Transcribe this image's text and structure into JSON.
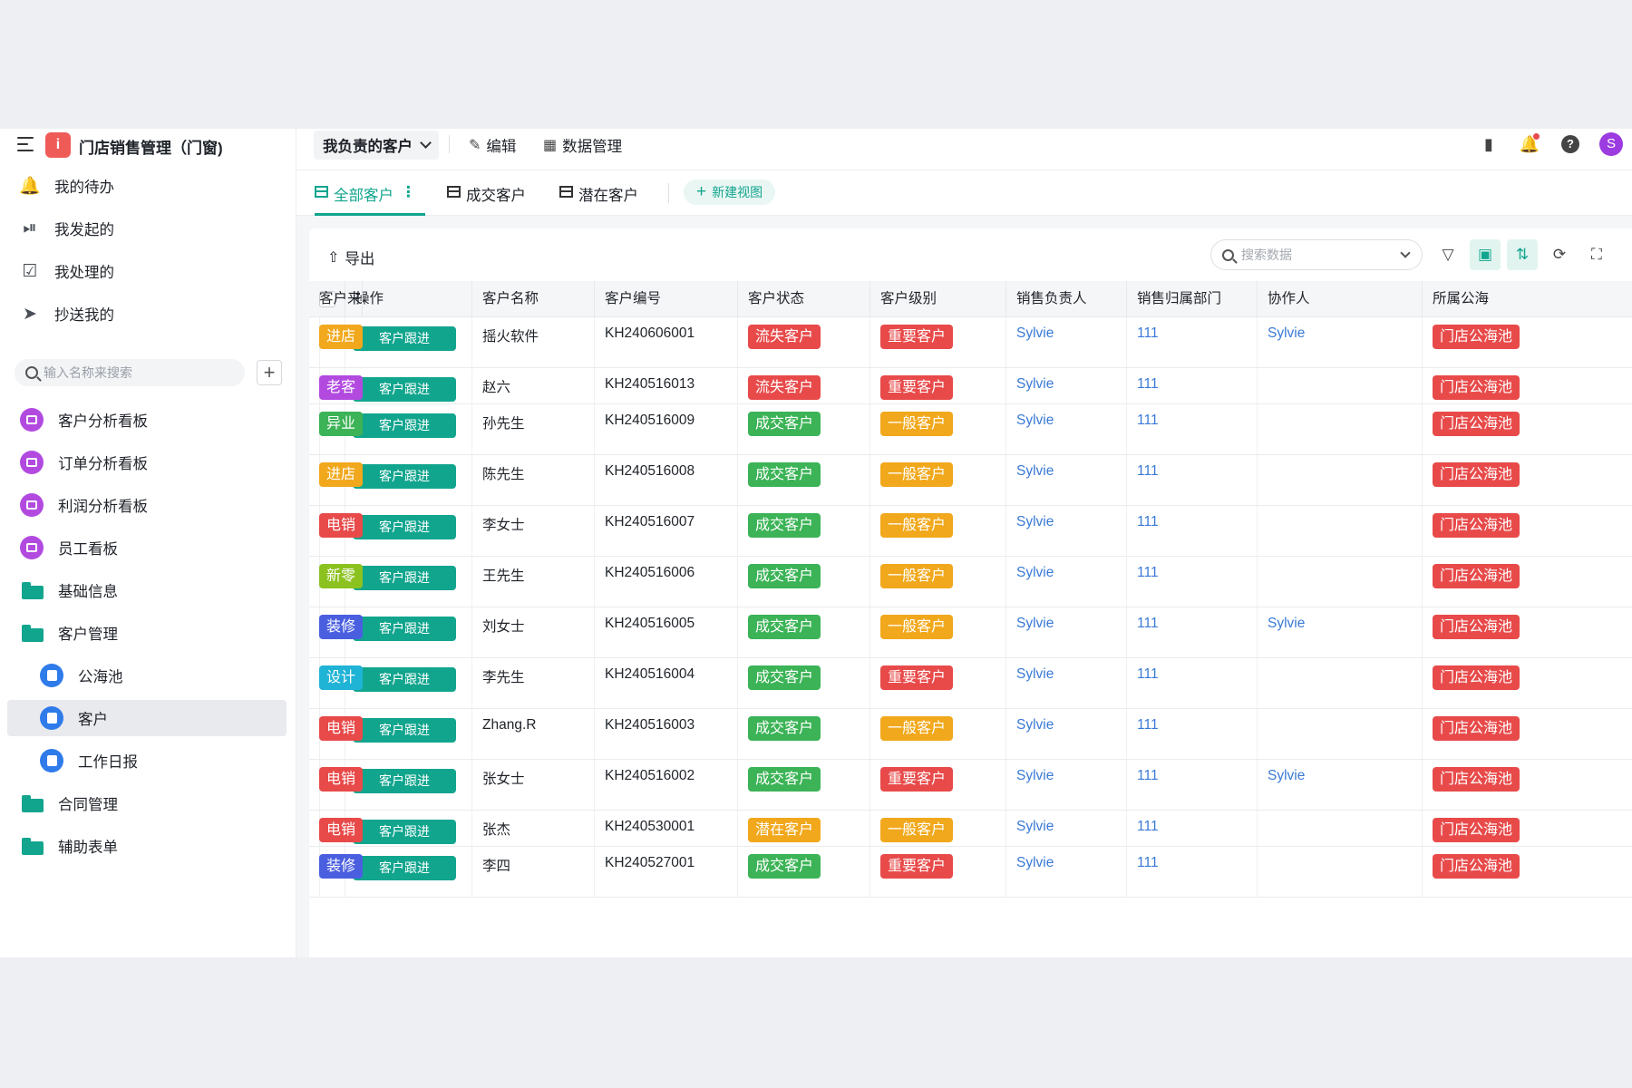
{
  "app": {
    "title": "门店销售管理（门窗)",
    "logo_glyph": "i",
    "accent": "#12a58e"
  },
  "sidebar": {
    "quick": [
      {
        "label": "我的待办",
        "icon": "bell-icon"
      },
      {
        "label": "我发起的",
        "icon": "play-circle-icon"
      },
      {
        "label": "我处理的",
        "icon": "check-calendar-icon"
      },
      {
        "label": "抄送我的",
        "icon": "send-icon"
      }
    ],
    "search_placeholder": "输入名称来搜索",
    "tree": [
      {
        "label": "客户分析看板",
        "icon": "dashboard-icon"
      },
      {
        "label": "订单分析看板",
        "icon": "dashboard-icon"
      },
      {
        "label": "利润分析看板",
        "icon": "dashboard-icon"
      },
      {
        "label": "员工看板",
        "icon": "dashboard-icon"
      },
      {
        "label": "基础信息",
        "icon": "folder-icon"
      },
      {
        "label": "客户管理",
        "icon": "folder-open-icon"
      },
      {
        "label": "公海池",
        "icon": "form-icon"
      },
      {
        "label": "客户",
        "icon": "form-icon",
        "active": true
      },
      {
        "label": "工作日报",
        "icon": "form-icon"
      },
      {
        "label": "合同管理",
        "icon": "folder-icon"
      },
      {
        "label": "辅助表单",
        "icon": "folder-icon"
      }
    ]
  },
  "topbar": {
    "view_label": "我负责的客户",
    "edit_label": "编辑",
    "data_mgmt_label": "数据管理",
    "avatar_letter": "S"
  },
  "tabs": {
    "items": [
      "全部客户",
      "成交客户",
      "潜在客户"
    ],
    "active": 0,
    "new_view_label": "新建视图"
  },
  "toolbar": {
    "export_label": "导出",
    "search_placeholder": "搜索数据"
  },
  "table": {
    "columns": [
      "操作",
      "客户名称",
      "客户编号",
      "客户状态",
      "客户级别",
      "销售负责人",
      "销售归属部门",
      "协作人",
      "所属公海",
      "客户来"
    ],
    "action_label": "客户跟进",
    "status_colors": {
      "流失客户": "#e84a4a",
      "成交客户": "#3bb356",
      "潜在客户": "#f1a81c"
    },
    "level_colors": {
      "重要客户": "#e84a4a",
      "一般客户": "#f1a81c"
    },
    "pool_color": "#e84a4a",
    "rows": [
      {
        "name": "摇火软件",
        "code": "KH240606001",
        "status": "流失客户",
        "level": "重要客户",
        "owner": "Sylvie",
        "dept": "111",
        "collab": "Sylvie",
        "pool": "门店公海池",
        "source": "进店",
        "source_color": "#f1a81c"
      },
      {
        "name": "赵六",
        "code": "KH240516013",
        "status": "流失客户",
        "level": "重要客户",
        "owner": "Sylvie",
        "dept": "111",
        "collab": "",
        "pool": "门店公海池",
        "source": "老客",
        "source_color": "#b24ae0"
      },
      {
        "name": "孙先生",
        "code": "KH240516009",
        "status": "成交客户",
        "level": "一般客户",
        "owner": "Sylvie",
        "dept": "111",
        "collab": "",
        "pool": "门店公海池",
        "source": "异业",
        "source_color": "#3bb356"
      },
      {
        "name": "陈先生",
        "code": "KH240516008",
        "status": "成交客户",
        "level": "一般客户",
        "owner": "Sylvie",
        "dept": "111",
        "collab": "",
        "pool": "门店公海池",
        "source": "进店",
        "source_color": "#f1a81c"
      },
      {
        "name": "李女士",
        "code": "KH240516007",
        "status": "成交客户",
        "level": "一般客户",
        "owner": "Sylvie",
        "dept": "111",
        "collab": "",
        "pool": "门店公海池",
        "source": "电销",
        "source_color": "#e84a4a"
      },
      {
        "name": "王先生",
        "code": "KH240516006",
        "status": "成交客户",
        "level": "一般客户",
        "owner": "Sylvie",
        "dept": "111",
        "collab": "",
        "pool": "门店公海池",
        "source": "新零",
        "source_color": "#8cc21f"
      },
      {
        "name": "刘女士",
        "code": "KH240516005",
        "status": "成交客户",
        "level": "一般客户",
        "owner": "Sylvie",
        "dept": "111",
        "collab": "Sylvie",
        "pool": "门店公海池",
        "source": "装修",
        "source_color": "#4a5fe0"
      },
      {
        "name": "李先生",
        "code": "KH240516004",
        "status": "成交客户",
        "level": "重要客户",
        "owner": "Sylvie",
        "dept": "111",
        "collab": "",
        "pool": "门店公海池",
        "source": "设计",
        "source_color": "#1fb3d6"
      },
      {
        "name": "Zhang.R",
        "code": "KH240516003",
        "status": "成交客户",
        "level": "一般客户",
        "owner": "Sylvie",
        "dept": "111",
        "collab": "",
        "pool": "门店公海池",
        "source": "电销",
        "source_color": "#e84a4a"
      },
      {
        "name": "张女士",
        "code": "KH240516002",
        "status": "成交客户",
        "level": "重要客户",
        "owner": "Sylvie",
        "dept": "111",
        "collab": "Sylvie",
        "pool": "门店公海池",
        "source": "电销",
        "source_color": "#e84a4a"
      },
      {
        "name": "张杰",
        "code": "KH240530001",
        "status": "潜在客户",
        "level": "一般客户",
        "owner": "Sylvie",
        "dept": "111",
        "collab": "",
        "pool": "门店公海池",
        "source": "电销",
        "source_color": "#e84a4a"
      },
      {
        "name": "李四",
        "code": "KH240527001",
        "status": "成交客户",
        "level": "重要客户",
        "owner": "Sylvie",
        "dept": "111",
        "collab": "",
        "pool": "门店公海池",
        "source": "装修",
        "source_color": "#4a5fe0"
      }
    ]
  }
}
